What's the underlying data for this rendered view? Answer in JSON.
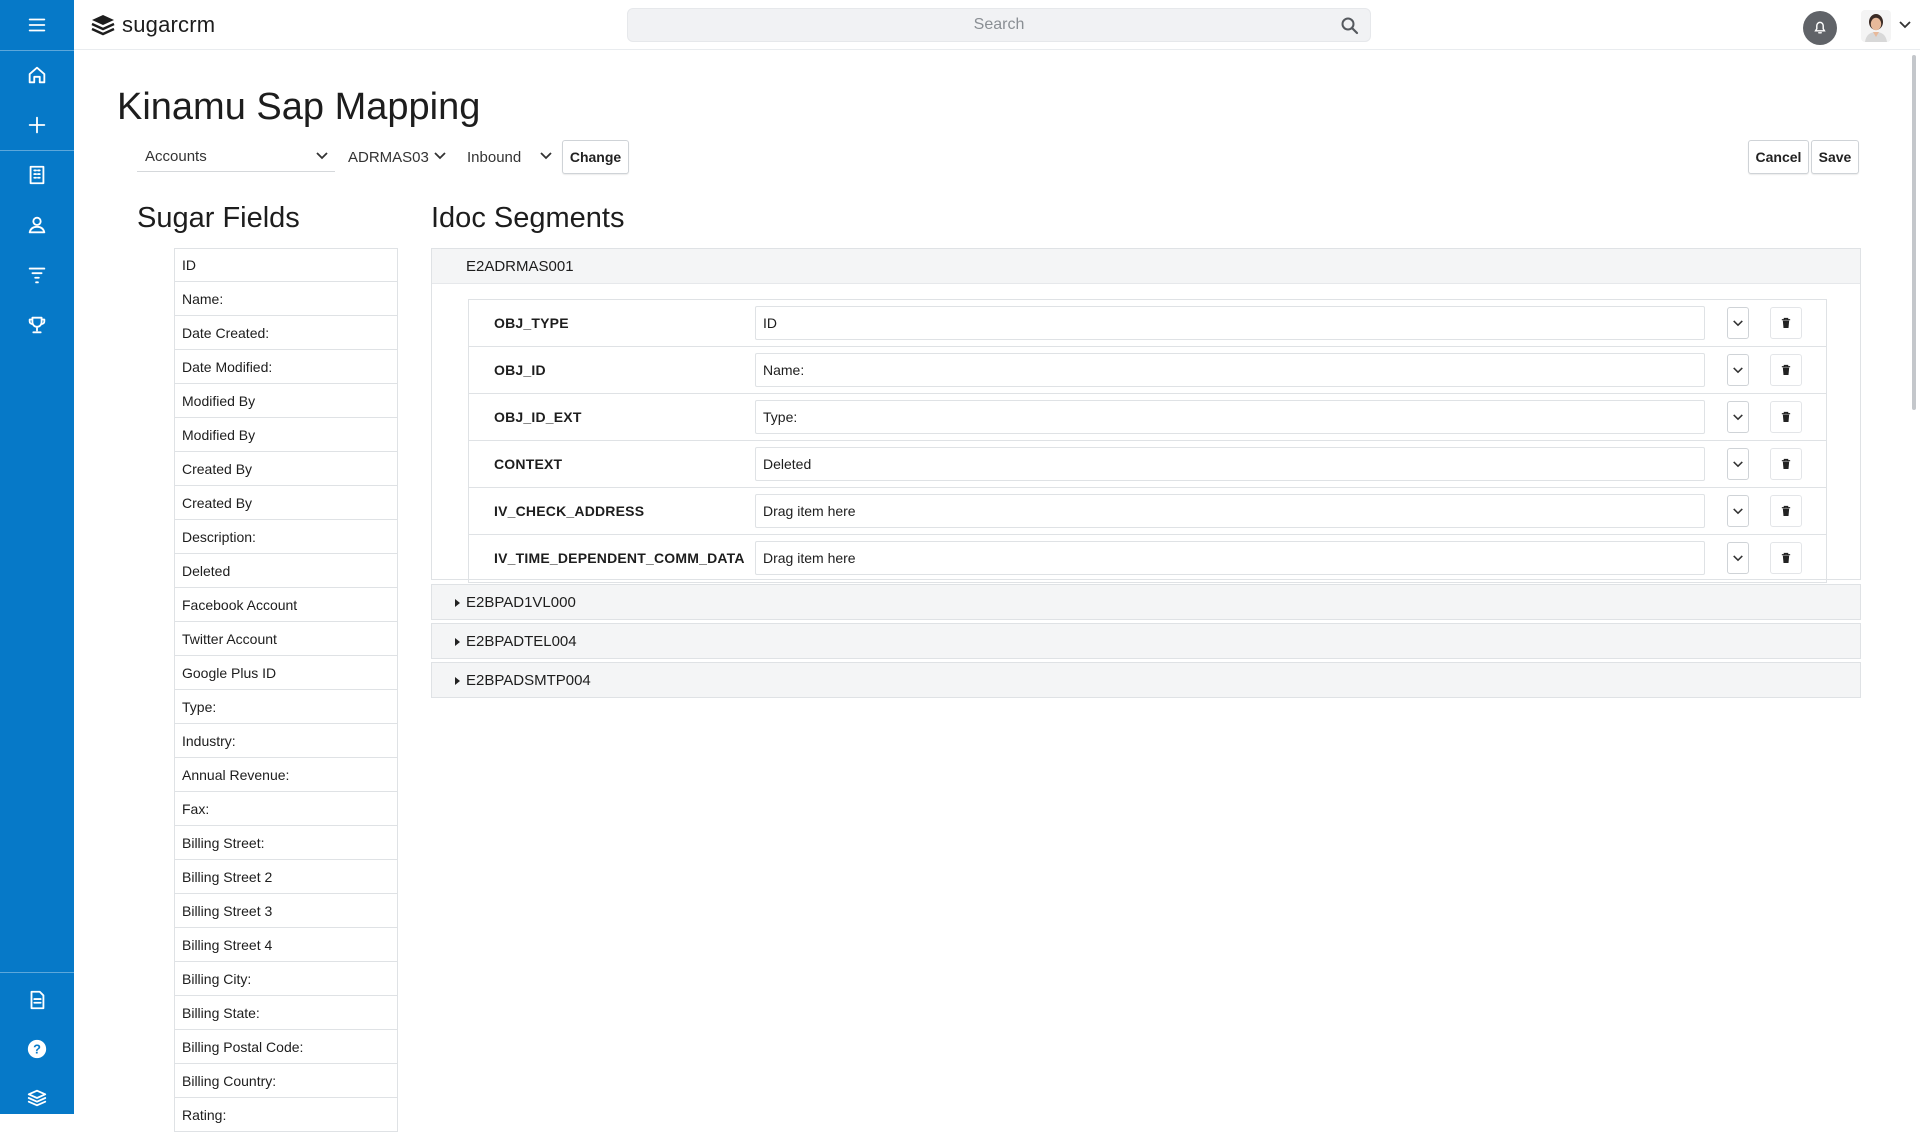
{
  "app": {
    "logo_text": "sugarcrm"
  },
  "search": {
    "placeholder": "Search"
  },
  "page": {
    "title": "Kinamu Sap Mapping"
  },
  "controls": {
    "module": "Accounts",
    "idoc_type": "ADRMAS03",
    "direction": "Inbound",
    "change_label": "Change",
    "cancel_label": "Cancel",
    "save_label": "Save"
  },
  "sugar_fields": {
    "title": "Sugar Fields",
    "items": [
      "ID",
      "Name:",
      "Date Created:",
      "Date Modified:",
      "Modified By",
      "Modified By",
      "Created By",
      "Created By",
      "Description:",
      "Deleted",
      "Facebook Account",
      "Twitter Account",
      "Google Plus ID",
      "Type:",
      "Industry:",
      "Annual Revenue:",
      "Fax:",
      "Billing Street:",
      "Billing Street 2",
      "Billing Street 3",
      "Billing Street 4",
      "Billing City:",
      "Billing State:",
      "Billing Postal Code:",
      "Billing Country:",
      "Rating:"
    ]
  },
  "idoc": {
    "title": "Idoc Segments",
    "open_segment": {
      "name": "E2ADRMAS001",
      "rows": [
        {
          "key": "OBJ_TYPE",
          "value": "ID"
        },
        {
          "key": "OBJ_ID",
          "value": "Name:"
        },
        {
          "key": "OBJ_ID_EXT",
          "value": "Type:"
        },
        {
          "key": "CONTEXT",
          "value": "Deleted"
        },
        {
          "key": "IV_CHECK_ADDRESS",
          "value": "Drag item here"
        },
        {
          "key": "IV_TIME_DEPENDENT_COMM_DATA",
          "value": "Drag item here"
        }
      ]
    },
    "collapsed_segments": [
      "E2BPAD1VL000",
      "E2BPADTEL004",
      "E2BPADSMTP004"
    ]
  },
  "icons": {
    "sidebar_top": [
      "menu-icon",
      "home-icon",
      "plus-icon",
      "building-icon",
      "user-icon",
      "filter-icon",
      "trophy-icon"
    ],
    "sidebar_bottom": [
      "document-icon",
      "help-icon",
      "layers-icon"
    ]
  },
  "colors": {
    "sidebar": "#0679c8",
    "notification_bg": "#606368"
  }
}
